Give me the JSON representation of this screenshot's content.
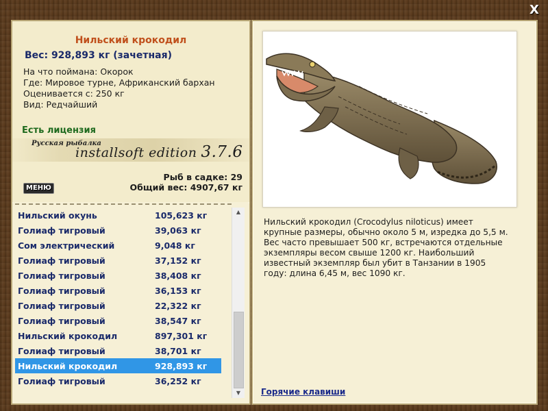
{
  "window": {
    "close_label": "X"
  },
  "fish": {
    "name": "Нильский крокодил",
    "weight_line": "Вес: 928,893 кг (зачетная)",
    "bait_line": "На что поймана: Окорок",
    "location_line": "Где: Мировое турне, Африканский бархан",
    "value_line": "Оценивается с: 250 кг",
    "rarity_line": "Вид: Редчайший"
  },
  "license": "Есть лицензия",
  "logo": {
    "small_text": "Русская рыбалка",
    "main_text": "installsoft edition",
    "version": "3.7.6"
  },
  "stats": {
    "fish_in_keepnet": "Рыб в садке: 29",
    "total_weight": "Общий вес: 4907,67 кг"
  },
  "menu_button": "МЕНЮ",
  "catch_list": [
    {
      "name": "Нильский окунь",
      "weight": "105,623 кг",
      "selected": false
    },
    {
      "name": "Голиаф тигровый",
      "weight": "39,063 кг",
      "selected": false
    },
    {
      "name": "Сом электрический",
      "weight": "9,048 кг",
      "selected": false
    },
    {
      "name": "Голиаф тигровый",
      "weight": "37,152 кг",
      "selected": false
    },
    {
      "name": "Голиаф тигровый",
      "weight": "38,408 кг",
      "selected": false
    },
    {
      "name": "Голиаф тигровый",
      "weight": "36,153 кг",
      "selected": false
    },
    {
      "name": "Голиаф тигровый",
      "weight": "22,322 кг",
      "selected": false
    },
    {
      "name": "Голиаф тигровый",
      "weight": "38,547 кг",
      "selected": false
    },
    {
      "name": "Нильский крокодил",
      "weight": "897,301 кг",
      "selected": false
    },
    {
      "name": "Голиаф тигровый",
      "weight": "38,701 кг",
      "selected": false
    },
    {
      "name": "Нильский крокодил",
      "weight": "928,893 кг",
      "selected": true
    },
    {
      "name": "Голиаф тигровый",
      "weight": "36,252 кг",
      "selected": false
    }
  ],
  "scrollbar": {
    "up_icon": "arrow-up-icon",
    "down_icon": "arrow-down-icon"
  },
  "description_lines": [
    "Нильский крокодил (Crocodylus niloticus) имеет",
    "крупные размеры, обычно около 5 м, изредка до 5,5 м.",
    "Вес часто превышает 500 кг, встречаются отдельные",
    "экземпляры весом свыше 1200 кг. Наибольший",
    "известный экземпляр был убит в Танзании в 1905",
    "году: длина 6,45 м, вес 1090 кг."
  ],
  "hotkeys_link": "Горячие клавиши",
  "colors": {
    "title": "#c0501c",
    "weight": "#1a2a6a",
    "license": "#1e6a1e",
    "selection": "#3096e6",
    "list_text": "#1a2a6a",
    "frame": "#5a3a1c"
  }
}
